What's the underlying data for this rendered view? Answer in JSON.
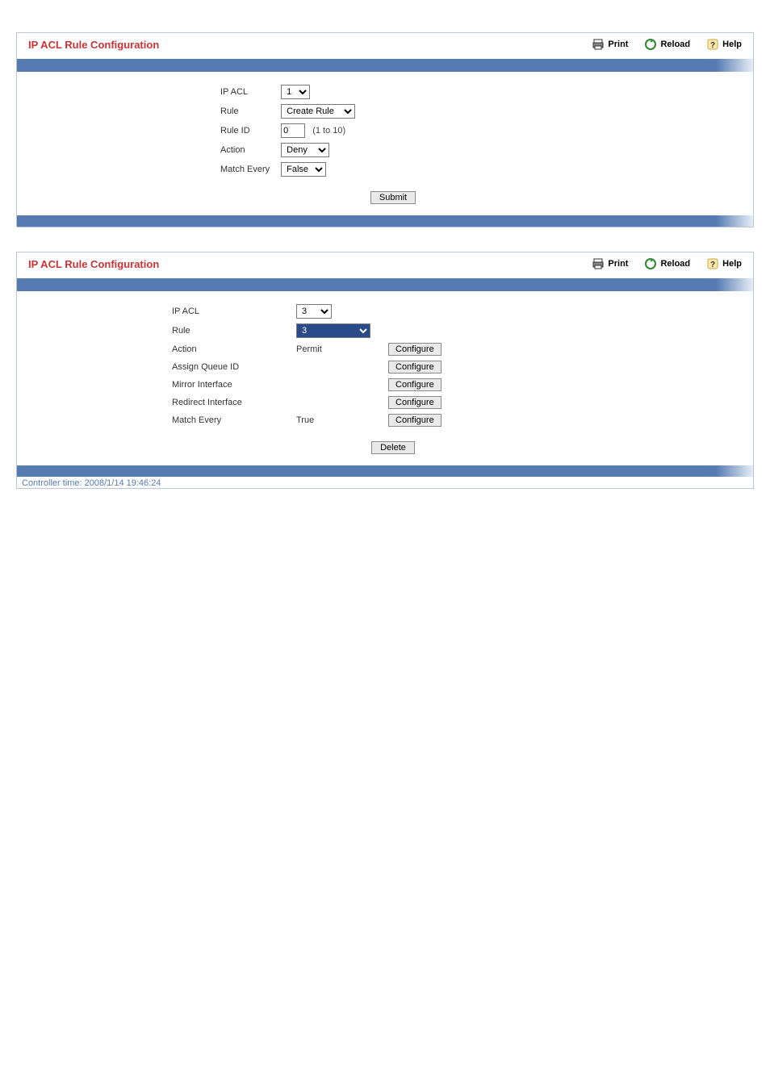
{
  "toolbar": {
    "print": "Print",
    "reload": "Reload",
    "help": "Help"
  },
  "panel1": {
    "title": "IP ACL Rule Configuration",
    "fields": {
      "ip_acl_label": "IP ACL",
      "ip_acl_value": "1",
      "rule_label": "Rule",
      "rule_value": "Create Rule",
      "rule_id_label": "Rule ID",
      "rule_id_value": "0",
      "rule_id_hint": "(1 to 10)",
      "action_label": "Action",
      "action_value": "Deny",
      "match_every_label": "Match Every",
      "match_every_value": "False"
    },
    "submit_label": "Submit"
  },
  "panel2": {
    "title": "IP ACL Rule Configuration",
    "fields": {
      "ip_acl_label": "IP ACL",
      "ip_acl_value": "3",
      "rule_label": "Rule",
      "rule_value": "3",
      "action_label": "Action",
      "action_value": "Permit",
      "assign_queue_label": "Assign Queue ID",
      "assign_queue_value": "",
      "mirror_interface_label": "Mirror Interface",
      "mirror_interface_value": "",
      "redirect_interface_label": "Redirect Interface",
      "redirect_interface_value": "",
      "match_every_label": "Match Every",
      "match_every_value": "True"
    },
    "configure_label": "Configure",
    "delete_label": "Delete"
  },
  "controller_time": "Controller time: 2008/1/14 19:46:24"
}
